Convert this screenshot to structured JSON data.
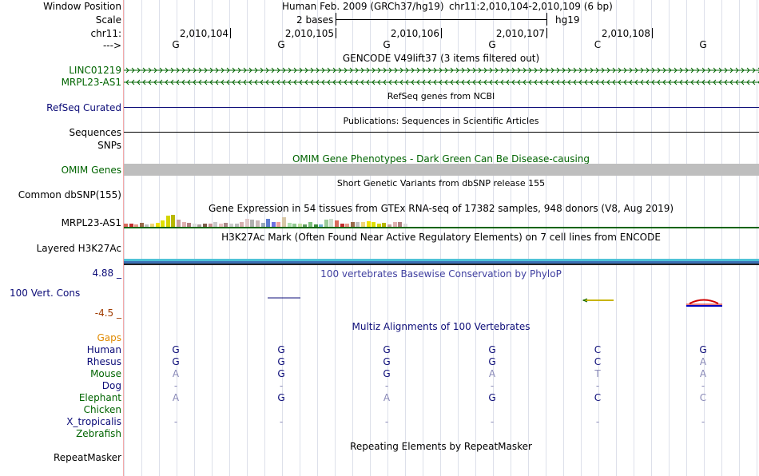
{
  "header": {
    "window_position_label": "Window Position",
    "scale_label": "Scale",
    "chrom_label": "chr11:",
    "arrow_label": "--->",
    "assembly_text": "Human Feb. 2009 (GRCh37/hg19)",
    "position_text": "chr11:2,010,104-2,010,109 (6 bp)",
    "scale_text": "2 bases",
    "scale_db": "hg19",
    "coords": [
      "2,010,104",
      "2,010,105",
      "2,010,106",
      "2,010,107",
      "2,010,108"
    ],
    "bases": [
      "G",
      "G",
      "G",
      "G",
      "C",
      "G"
    ]
  },
  "gencode": {
    "title": "GENCODE V49lift37 (3 items filtered out)",
    "tracks": [
      "LINC01219",
      "MRPL23-AS1"
    ],
    "color": "#006400"
  },
  "refseq": {
    "label": "RefSeq Curated",
    "title": "RefSeq genes from NCBI",
    "color": "#0c0c78"
  },
  "publications": {
    "label": "Sequences",
    "title": "Publications: Sequences in Scientific Articles"
  },
  "snps": {
    "label": "SNPs"
  },
  "omim": {
    "label": "OMIM Genes",
    "title": "OMIM Gene Phenotypes - Dark Green Can Be Disease-causing",
    "color": "#006400"
  },
  "dbsnp": {
    "title": "Short Genetic Variants from dbSNP release 155",
    "label": "Common dbSNP(155)"
  },
  "gtex": {
    "title": "Gene Expression in 54 tissues from GTEx RNA-seq of 17382 samples, 948 donors (V8, Aug 2019)",
    "label": "MRPL23-AS1"
  },
  "h3k27ac": {
    "title": "H3K27Ac Mark (Often Found Near Active Regulatory Elements) on 7 cell lines from ENCODE",
    "label": "Layered H3K27Ac"
  },
  "conservation": {
    "title": "100 vertebrates Basewise Conservation by PhyloP",
    "label": "100 Vert. Cons",
    "max": "4.88 _",
    "min": "-4.5 _",
    "max_color": "#0c0c78",
    "min_color": "#a03c00"
  },
  "multiz": {
    "title": "Multiz Alignments of 100 Vertebrates",
    "gaps_label": "Gaps",
    "species": [
      {
        "name": "Human",
        "color": "#0c0c78",
        "bases": [
          "G",
          "G",
          "G",
          "G",
          "C",
          "G"
        ],
        "faded": [
          false,
          false,
          false,
          false,
          false,
          false
        ]
      },
      {
        "name": "Rhesus",
        "color": "#0c0c78",
        "bases": [
          "G",
          "G",
          "G",
          "G",
          "C",
          "A"
        ],
        "faded": [
          false,
          false,
          false,
          false,
          false,
          true
        ]
      },
      {
        "name": "Mouse",
        "color": "#006400",
        "bases": [
          "A",
          "G",
          "G",
          "A",
          "T",
          "A"
        ],
        "faded": [
          true,
          false,
          false,
          true,
          true,
          true
        ]
      },
      {
        "name": "Dog",
        "color": "#0c0c78",
        "bases": [
          "-",
          "-",
          "-",
          "-",
          "-",
          "-"
        ],
        "faded": [
          true,
          true,
          true,
          true,
          true,
          true
        ]
      },
      {
        "name": "Elephant",
        "color": "#006400",
        "bases": [
          "A",
          "G",
          "A",
          "G",
          "C",
          "C"
        ],
        "faded": [
          true,
          false,
          true,
          false,
          false,
          true
        ]
      },
      {
        "name": "Chicken",
        "color": "#006400",
        "bases": [
          "",
          "",
          "",
          "",
          "",
          ""
        ],
        "faded": [
          true,
          true,
          true,
          true,
          true,
          true
        ]
      },
      {
        "name": "X_tropicalis",
        "color": "#0c0c78",
        "bases": [
          "-",
          "-",
          "-",
          "-",
          "-",
          "-"
        ],
        "faded": [
          true,
          true,
          true,
          true,
          true,
          true
        ]
      },
      {
        "name": "Zebrafish",
        "color": "#006400",
        "bases": [
          "",
          "",
          "",
          "",
          "",
          ""
        ],
        "faded": [
          true,
          true,
          true,
          true,
          true,
          true
        ]
      }
    ]
  },
  "repeatmasker": {
    "title": "Repeating Elements by RepeatMasker",
    "label": "RepeatMasker"
  }
}
